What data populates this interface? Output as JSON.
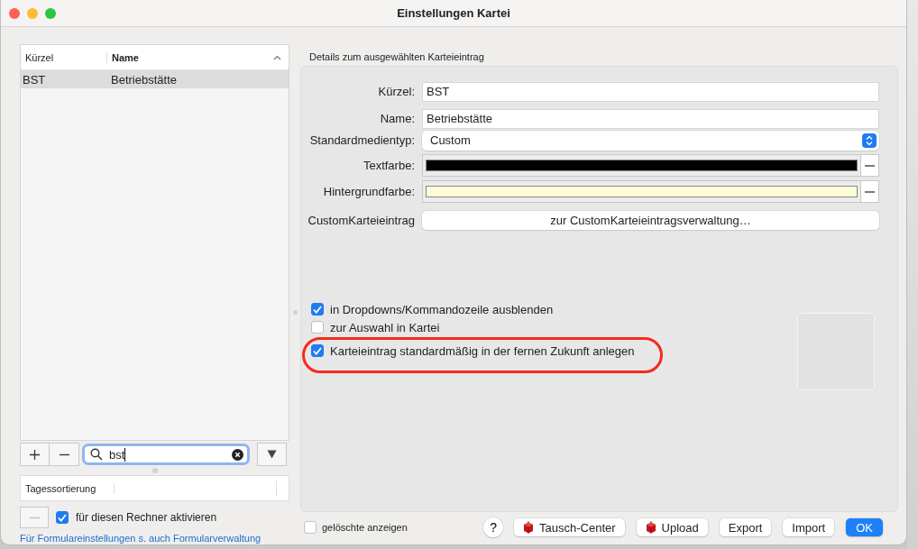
{
  "window": {
    "title": "Einstellungen Kartei"
  },
  "list": {
    "columns": [
      "Kürzel",
      "Name"
    ],
    "rows": [
      {
        "cells": [
          "BST",
          "Betriebstätte"
        ],
        "selected": true
      }
    ]
  },
  "search": {
    "value": "bst"
  },
  "sort_table": {
    "columns": [
      "Tagessortierung"
    ]
  },
  "activate": {
    "label": "für diesen Rechner aktivieren",
    "checked": true
  },
  "link": "Für Formulareinstellungen s. auch Formularverwaltung",
  "details": {
    "title": "Details zum ausgewählten Karteieintrag",
    "fields": [
      {
        "kind": "text",
        "label": "Kürzel:",
        "value": "BST"
      },
      {
        "kind": "text",
        "label": "Name:",
        "value": "Betriebstätte"
      },
      {
        "kind": "select",
        "label": "Standardmedientyp:",
        "value": "Custom"
      },
      {
        "kind": "color",
        "label": "Textfarbe:",
        "color": "#000000"
      },
      {
        "kind": "color",
        "label": "Hintergrundfarbe:",
        "color": "#fffbd6"
      },
      {
        "kind": "button",
        "label": "CustomKarteieintrag",
        "value": "zur CustomKarteieintragsverwaltung…"
      }
    ],
    "options": [
      {
        "label": "in Dropdowns/Kommandozeile ausblenden",
        "checked": true
      },
      {
        "label": "zur Auswahl in Kartei",
        "checked": false
      },
      {
        "label": "Karteieintrag standardmäßig in der fernen Zukunft anlegen",
        "checked": true
      }
    ]
  },
  "show_deleted": {
    "label": "gelöschte anzeigen",
    "checked": false
  },
  "buttons": [
    {
      "kind": "help",
      "label": "?"
    },
    {
      "kind": "icon",
      "label": "Tausch-Center"
    },
    {
      "kind": "icon",
      "label": "Upload"
    },
    {
      "kind": "plain",
      "label": "Export"
    },
    {
      "kind": "plain",
      "label": "Import"
    },
    {
      "kind": "default",
      "label": "OK"
    }
  ]
}
